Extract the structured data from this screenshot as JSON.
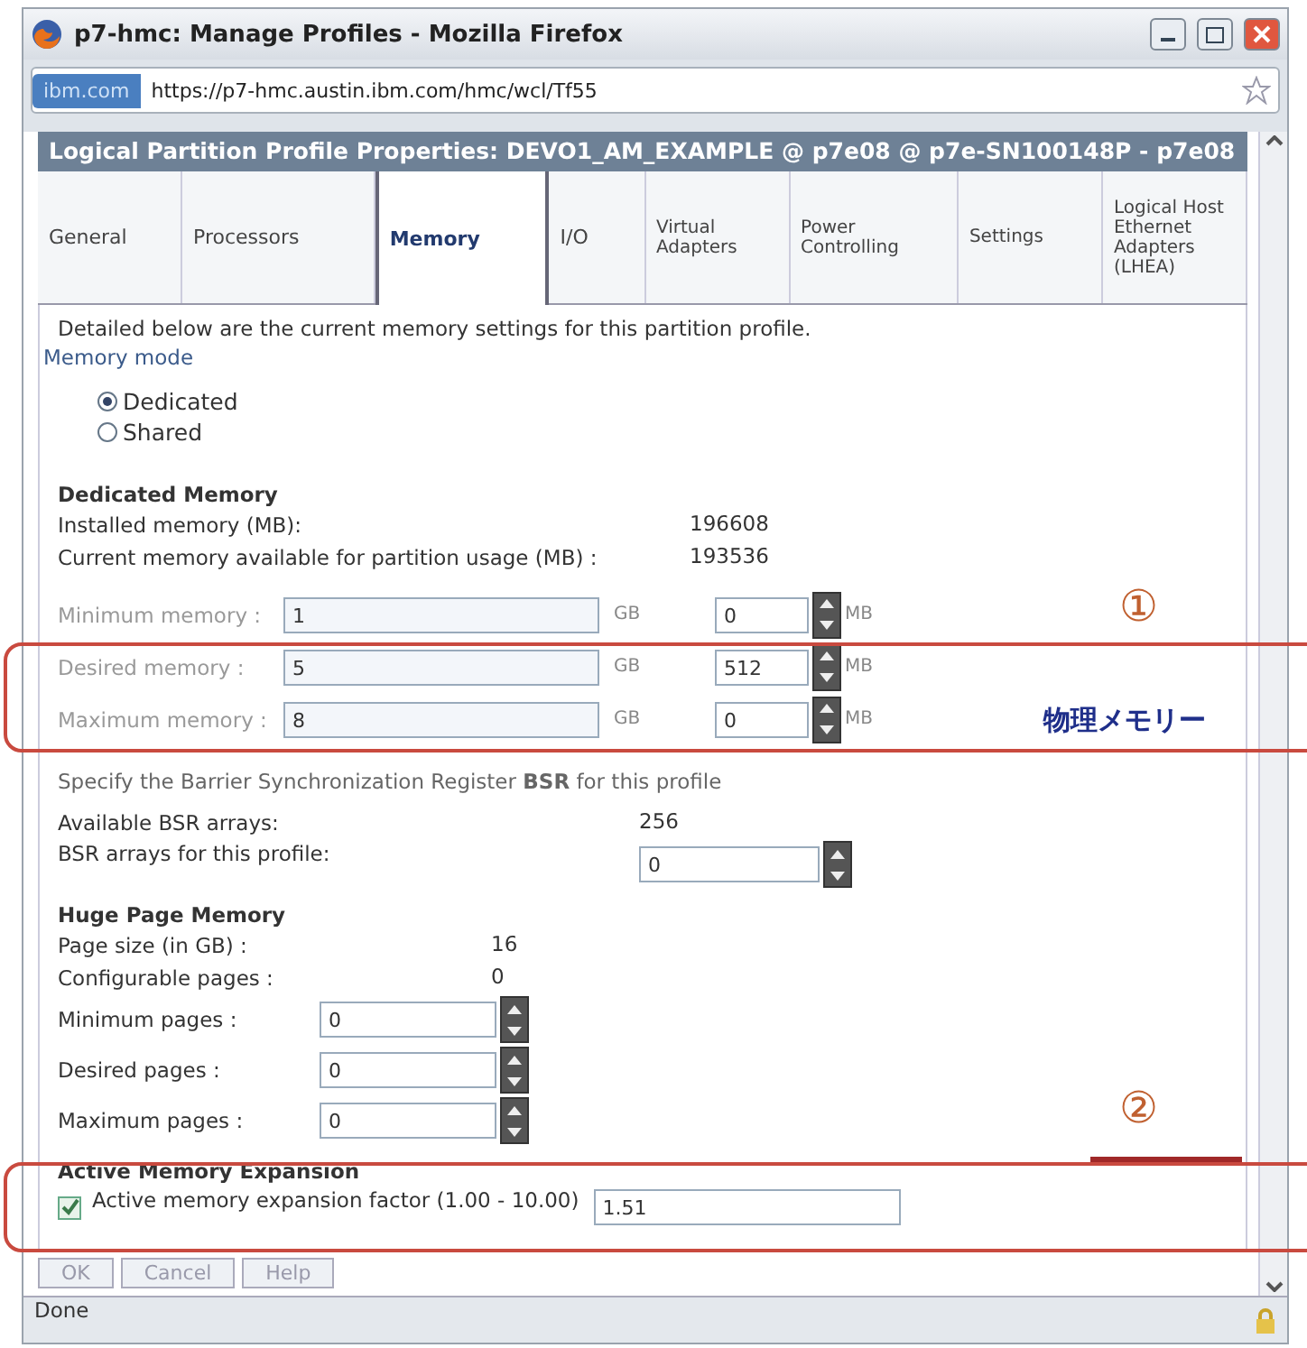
{
  "window": {
    "title": "p7-hmc: Manage Profiles - Mozilla Firefox",
    "site_label": "ibm.com",
    "url": "https://p7-hmc.austin.ibm.com/hmc/wcl/Tf55"
  },
  "dialog": {
    "title": "Logical Partition Profile Properties: DEVO1_AM_EXAMPLE @ p7e08 @ p7e-SN100148P - p7e08",
    "tabs": [
      {
        "label": "General",
        "selected": false
      },
      {
        "label": "Processors",
        "selected": false
      },
      {
        "label": "Memory",
        "selected": true
      },
      {
        "label": "I/O",
        "selected": false
      },
      {
        "label": "Virtual Adapters",
        "selected": false
      },
      {
        "label": "Power Controlling",
        "selected": false
      },
      {
        "label": "Settings",
        "selected": false
      },
      {
        "label": "Logical Host Ethernet Adapters (LHEA)",
        "selected": false
      }
    ],
    "intro": "Detailed below are the current memory settings for this partition profile.",
    "memory_mode": {
      "label": "Memory mode",
      "options": [
        {
          "label": "Dedicated",
          "selected": true
        },
        {
          "label": "Shared",
          "selected": false
        }
      ]
    },
    "dedicated": {
      "heading": "Dedicated Memory",
      "info": [
        {
          "label": "Installed memory (MB):",
          "value": "196608"
        },
        {
          "label": "Current memory available for partition usage (MB) :",
          "value": "193536"
        }
      ],
      "fields": [
        {
          "label": "Minimum memory :",
          "gb": "1",
          "gb_unit": "GB",
          "mb": "0",
          "mb_unit": "MB"
        },
        {
          "label": "Desired memory :",
          "gb": "5",
          "gb_unit": "GB",
          "mb": "512",
          "mb_unit": "MB"
        },
        {
          "label": "Maximum memory :",
          "gb": "8",
          "gb_unit": "GB",
          "mb": "0",
          "mb_unit": "MB"
        }
      ]
    },
    "bsr": {
      "intro": "Specify the Barrier Synchronization Register **BSR** for this profile",
      "available_label": "Available BSR arrays:",
      "available_value": "256",
      "profile_label": "BSR arrays for this profile:",
      "profile_value": "0"
    },
    "huge_pages": {
      "heading": "Huge Page Memory",
      "info": [
        {
          "label": "Page size (in GB) :",
          "value": "16"
        },
        {
          "label": "Configurable pages :",
          "value": "0"
        }
      ],
      "fields": [
        {
          "label": "Minimum pages :",
          "value": "0"
        },
        {
          "label": "Desired pages :",
          "value": "0"
        },
        {
          "label": "Maximum pages :",
          "value": "0"
        }
      ]
    },
    "ame": {
      "heading": "Active Memory Expansion",
      "checkbox": {
        "label": "Active memory expansion factor (1.00 - 10.00)",
        "checked": true
      },
      "value": "1.51"
    },
    "buttons": [
      "OK",
      "Cancel",
      "Help"
    ]
  },
  "status_bar": "Done",
  "annotations": [
    {
      "number": "①",
      "label": "物理メモリー"
    },
    {
      "number": "②"
    }
  ]
}
